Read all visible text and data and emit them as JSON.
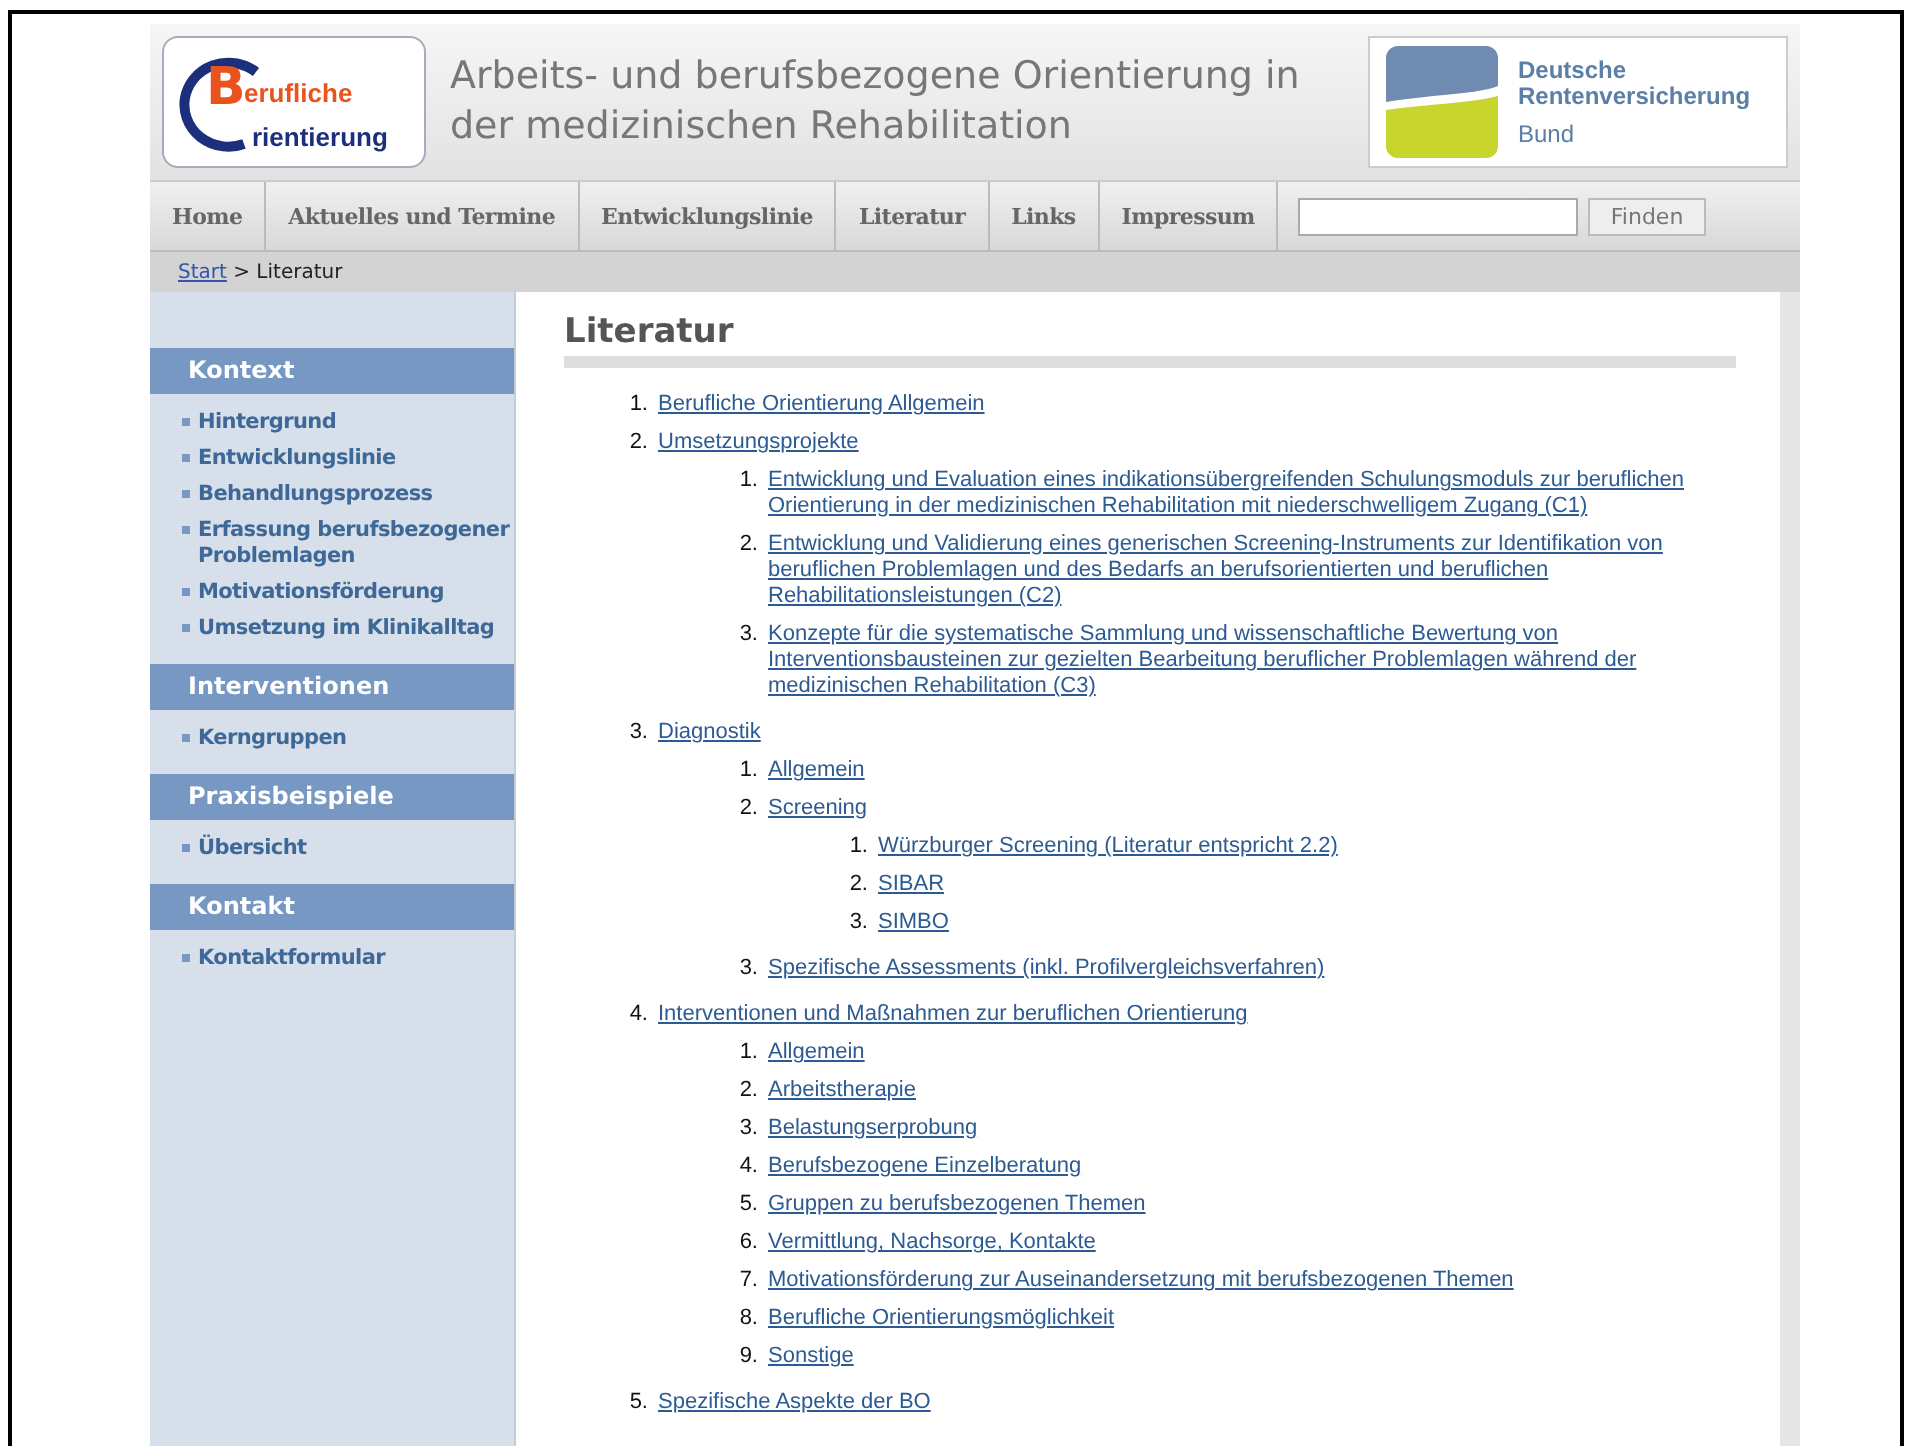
{
  "logo": {
    "big_letter": "B",
    "line1": "erufliche",
    "line2": "rientierung"
  },
  "site_title": "Arbeits- und berufsbezogene Orientierung in der medizinischen Rehabilitation",
  "partner_logo": {
    "line1": "Deutsche",
    "line2": "Rentenversicherung",
    "line3": "Bund"
  },
  "nav": [
    {
      "label": "Home"
    },
    {
      "label": "Aktuelles und Termine"
    },
    {
      "label": "Entwicklungslinie"
    },
    {
      "label": "Literatur"
    },
    {
      "label": "Links"
    },
    {
      "label": "Impressum"
    }
  ],
  "search": {
    "button": "Finden"
  },
  "breadcrumb": {
    "link": "Start",
    "rest": " > Literatur"
  },
  "sidebar": [
    {
      "heading": "Kontext",
      "items": [
        "Hintergrund",
        "Entwicklungslinie",
        "Behandlungsprozess",
        "Erfassung berufsbezogener Problemlagen",
        "Motivationsförderung",
        "Umsetzung im Klinikalltag"
      ]
    },
    {
      "heading": "Interventionen",
      "items": [
        "Kerngruppen"
      ]
    },
    {
      "heading": "Praxisbeispiele",
      "items": [
        "Übersicht"
      ]
    },
    {
      "heading": "Kontakt",
      "items": [
        "Kontaktformular"
      ]
    }
  ],
  "heading": "Literatur",
  "literature": [
    {
      "num": "1.",
      "title": "Berufliche Orientierung Allgemein"
    },
    {
      "num": "2.",
      "title": "Umsetzungsprojekte",
      "children": [
        {
          "num": "1.",
          "title": "Entwicklung und Evaluation eines indikationsübergreifenden Schulungsmoduls zur beruflichen Orientierung in der medizinischen Rehabilitation mit niederschwelligem Zugang (C1)"
        },
        {
          "num": "2.",
          "title": "Entwicklung und Validierung eines generischen Screening-Instruments zur Identifikation von beruflichen Problemlagen und des Bedarfs an berufsorientierten und beruflichen Rehabilitationsleistungen (C2)"
        },
        {
          "num": "3.",
          "title": "Konzepte für die systematische Sammlung und wissenschaftliche Bewertung von Interventionsbausteinen zur gezielten Bearbeitung beruflicher Problemlagen während der medizinischen Rehabilitation (C3)"
        }
      ]
    },
    {
      "num": "3.",
      "title": "Diagnostik",
      "children": [
        {
          "num": "1.",
          "title": "Allgemein"
        },
        {
          "num": "2.",
          "title": "Screening",
          "children": [
            {
              "num": "1.",
              "title": "Würzburger Screening (Literatur entspricht 2.2)"
            },
            {
              "num": "2.",
              "title": "SIBAR"
            },
            {
              "num": "3.",
              "title": "SIMBO"
            }
          ]
        },
        {
          "num": "3.",
          "title": "Spezifische Assessments (inkl. Profilvergleichsverfahren)"
        }
      ]
    },
    {
      "num": "4.",
      "title": "Interventionen und Maßnahmen zur beruflichen Orientierung",
      "children": [
        {
          "num": "1.",
          "title": "Allgemein"
        },
        {
          "num": "2.",
          "title": "Arbeitstherapie"
        },
        {
          "num": "3.",
          "title": "Belastungserprobung"
        },
        {
          "num": "4.",
          "title": "Berufsbezogene Einzelberatung"
        },
        {
          "num": "5.",
          "title": "Gruppen zu berufsbezogenen Themen"
        },
        {
          "num": "6.",
          "title": "Vermittlung, Nachsorge, Kontakte"
        },
        {
          "num": "7.",
          "title": "Motivationsförderung zur Auseinandersetzung mit berufsbezogenen Themen"
        },
        {
          "num": "8.",
          "title": "Berufliche Orientierungsmöglichkeit"
        },
        {
          "num": "9.",
          "title": "Sonstige"
        }
      ]
    },
    {
      "num": "5.",
      "title": "Spezifische Aspekte der BO"
    }
  ]
}
